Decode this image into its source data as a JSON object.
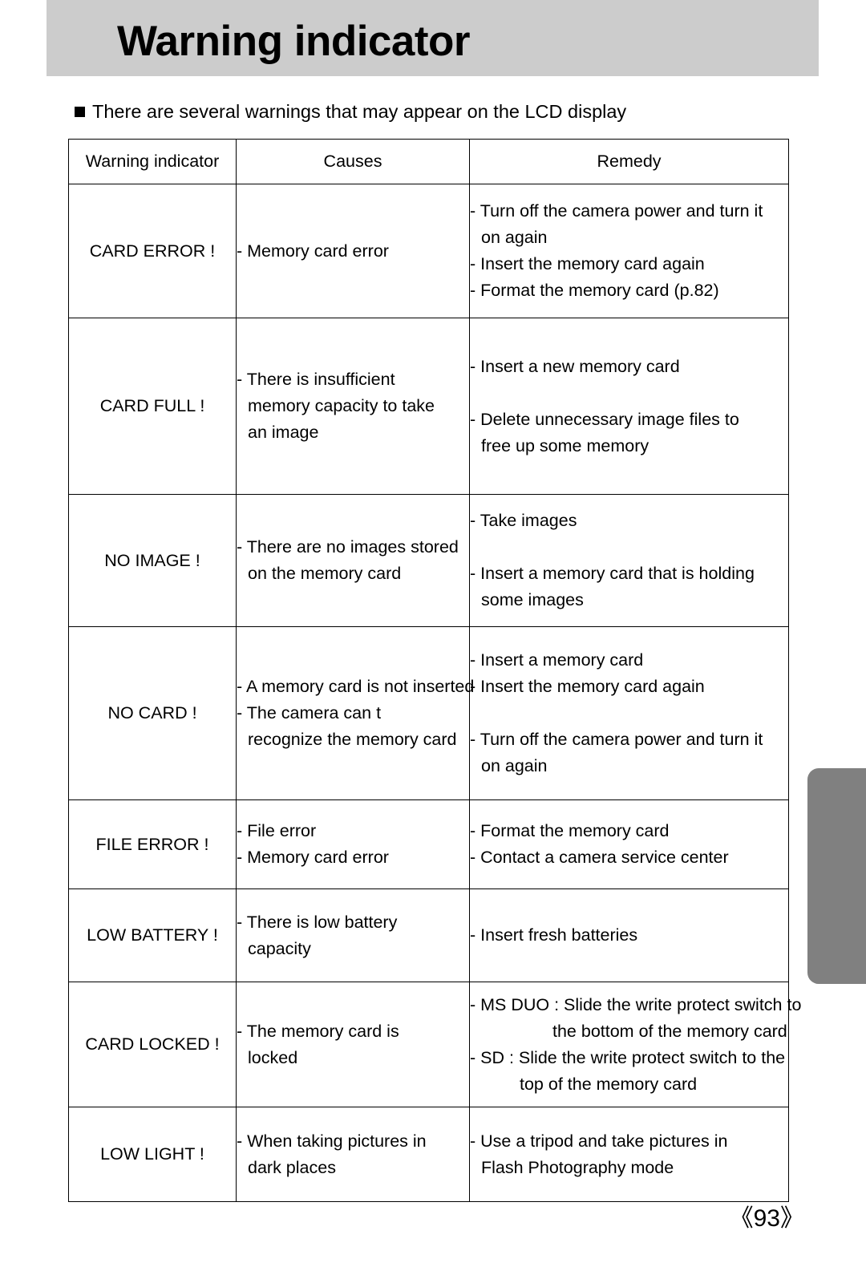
{
  "document": {
    "title": "Warning indicator",
    "intro": "There are several warnings that may appear on the LCD display",
    "intro_bullet_icon": "filled-square-bullet-icon",
    "page_number": "《93》"
  },
  "colors": {
    "header_band": "#cccccc",
    "side_tab": "#808080",
    "table_border": "#000000",
    "text": "#000000",
    "page_background": "#ffffff"
  },
  "table": {
    "columns": [
      "Warning indicator",
      "Causes",
      "Remedy"
    ],
    "rows": [
      {
        "indicator": "CARD ERROR !",
        "causes": [
          "- Memory card error"
        ],
        "remedy": [
          "- Turn off the camera power and turn it",
          "on again",
          "- Insert the memory card again",
          "- Format the memory card (p.82)"
        ]
      },
      {
        "indicator": "CARD FULL !",
        "causes": [
          "- There is insufficient",
          "memory capacity to take",
          "an image"
        ],
        "remedy": [
          "- Insert a new memory card",
          "",
          "- Delete unnecessary image files to",
          "free up some memory"
        ]
      },
      {
        "indicator": "NO IMAGE !",
        "causes": [
          "- There are no images stored",
          "on the memory card"
        ],
        "remedy": [
          "- Take images",
          "",
          "- Insert a memory card that is holding",
          "some images"
        ]
      },
      {
        "indicator": "NO CARD !",
        "causes": [
          "- A memory card is not inserted",
          "- The camera can  t",
          "recognize the memory card"
        ],
        "remedy": [
          "- Insert a memory card",
          "- Insert the memory card again",
          "",
          "- Turn off the camera power and turn it",
          "on again"
        ]
      },
      {
        "indicator": "FILE ERROR !",
        "causes": [
          "- File error",
          "- Memory card error"
        ],
        "remedy": [
          "- Format the memory card",
          "- Contact a camera service center"
        ]
      },
      {
        "indicator": "LOW BATTERY !",
        "causes": [
          "- There is low battery",
          "capacity"
        ],
        "remedy": [
          "- Insert fresh batteries"
        ]
      },
      {
        "indicator": "CARD LOCKED !",
        "causes": [
          "- The memory card is",
          "locked"
        ],
        "remedy": [
          "- MS DUO : Slide the write protect switch to",
          "the bottom of the memory card",
          "- SD : Slide the write protect switch to the",
          "top of the memory card"
        ]
      },
      {
        "indicator": "LOW LIGHT !",
        "causes": [
          "- When taking pictures in",
          "dark places"
        ],
        "remedy": [
          "- Use a tripod and take pictures in",
          "Flash Photography mode"
        ]
      }
    ]
  }
}
